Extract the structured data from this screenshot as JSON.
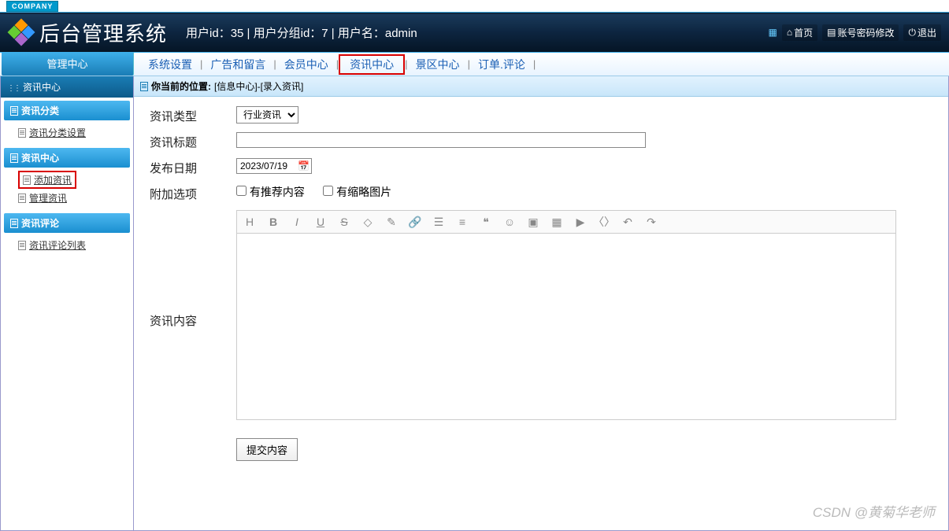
{
  "brand_tag": "COMPANY",
  "title": "后台管理系统",
  "userinfo": "用户id：35 | 用户分组id：7 | 用户名：admin",
  "header_links": {
    "home": "首页",
    "pwd": "账号密码修改",
    "logout": "退出"
  },
  "topnav": {
    "control": "管理中心",
    "items": [
      "系统设置",
      "广告和留言",
      "会员中心",
      "资讯中心",
      "景区中心",
      "订单.评论"
    ],
    "active_index": 3
  },
  "sidebar": {
    "title": "资讯中心",
    "groups": [
      {
        "head": "资讯分类",
        "items": [
          {
            "label": "资讯分类设置",
            "hl": false
          }
        ]
      },
      {
        "head": "资讯中心",
        "items": [
          {
            "label": "添加资讯",
            "hl": true
          },
          {
            "label": "管理资讯",
            "hl": false
          }
        ]
      },
      {
        "head": "资讯评论",
        "items": [
          {
            "label": "资讯评论列表",
            "hl": false
          }
        ]
      }
    ]
  },
  "crumb": {
    "label": "你当前的位置:",
    "path": "[信息中心]-[录入资讯]"
  },
  "form": {
    "type_label": "资讯类型",
    "type_value": "行业资讯",
    "title_label": "资讯标题",
    "title_value": "",
    "date_label": "发布日期",
    "date_value": "2023/07/19",
    "options_label": "附加选项",
    "opt1": "有推荐内容",
    "opt2": "有缩略图片",
    "content_label": "资讯内容",
    "content_value": "",
    "submit": "提交内容"
  },
  "toolbar_icons": [
    "heading",
    "bold",
    "italic",
    "underline",
    "strike",
    "eraser",
    "brush",
    "link",
    "list-ul",
    "list-ol",
    "quote",
    "smile",
    "image",
    "table",
    "video",
    "code",
    "undo",
    "redo"
  ],
  "watermark": "CSDN @黄菊华老师"
}
